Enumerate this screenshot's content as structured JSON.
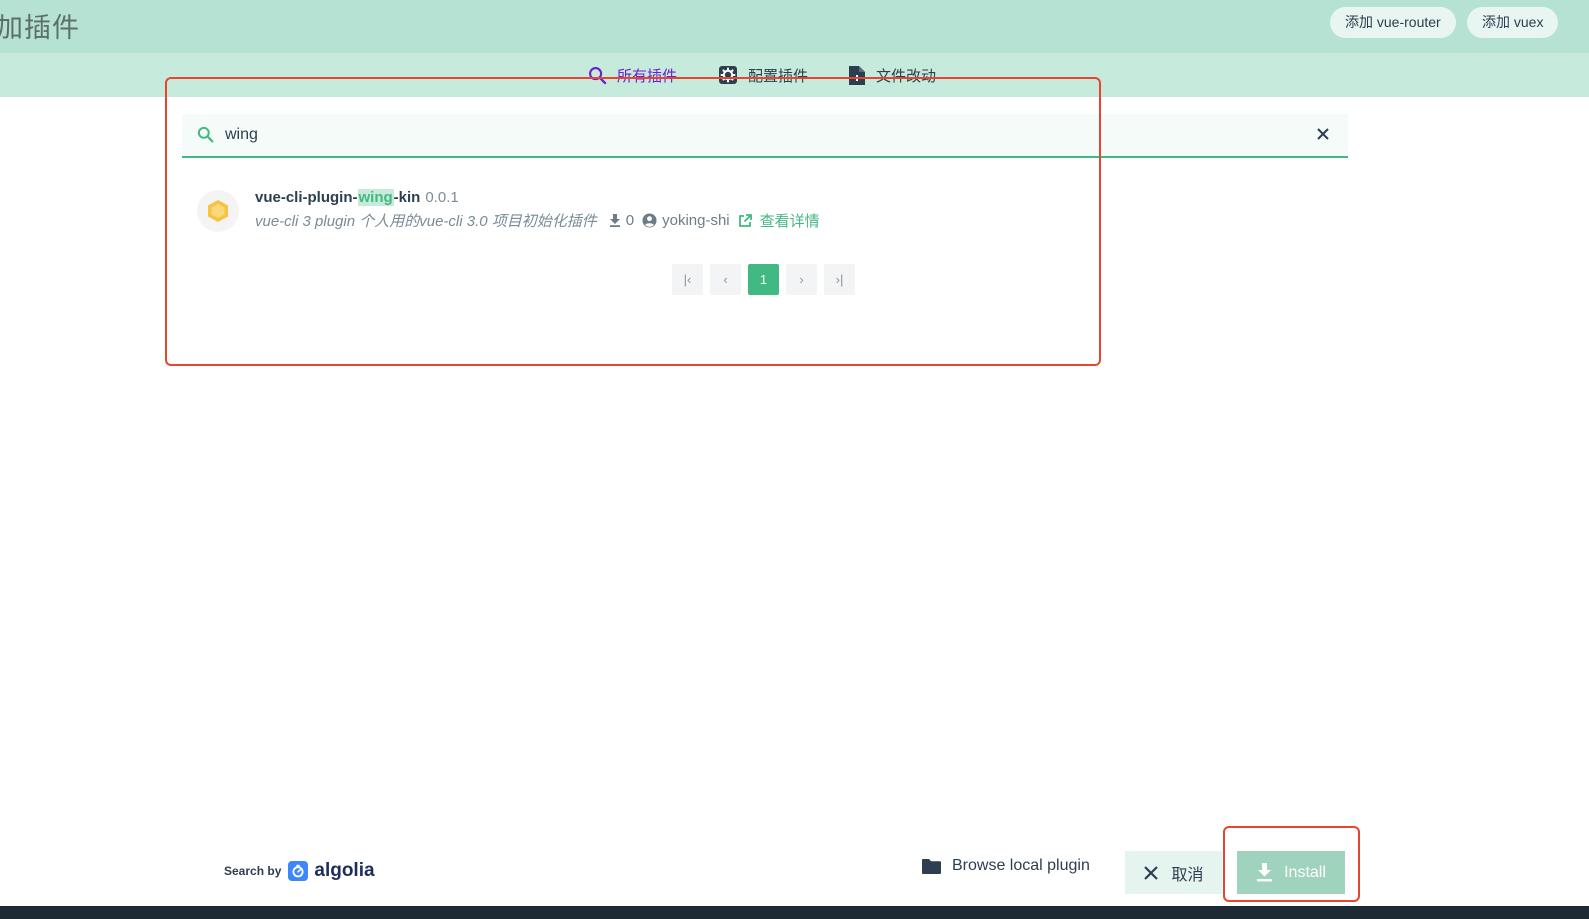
{
  "header": {
    "title": "加插件",
    "add_router": "添加 vue-router",
    "add_vuex": "添加 vuex"
  },
  "tabs": [
    {
      "label": "所有插件",
      "icon": "search-icon",
      "active": true
    },
    {
      "label": "配置插件",
      "icon": "gear-icon"
    },
    {
      "label": "文件改动",
      "icon": "file-icon"
    }
  ],
  "search": {
    "value": "wing",
    "placeholder": ""
  },
  "results": [
    {
      "name_prefix": "vue-cli-plugin-",
      "name_match": "wing",
      "name_suffix": "-kin",
      "version": "0.0.1",
      "description": "vue-cli 3 plugin 个人用的vue-cli 3.0 项目初始化插件",
      "downloads": "0",
      "author": "yoking-shi",
      "detail_label": "查看详情"
    }
  ],
  "pagination": {
    "first": "|‹",
    "prev": "‹",
    "current": "1",
    "next": "›",
    "last": "›|"
  },
  "footer": {
    "search_by": "Search by",
    "algolia": "algolia",
    "browse_local": "Browse local plugin",
    "cancel": "取消",
    "install": "Install"
  },
  "colors": {
    "accent": "#42b983",
    "header_bg": "#b6e2d3",
    "active_tab": "#6a1fd1",
    "annotation": "#e8442e"
  }
}
